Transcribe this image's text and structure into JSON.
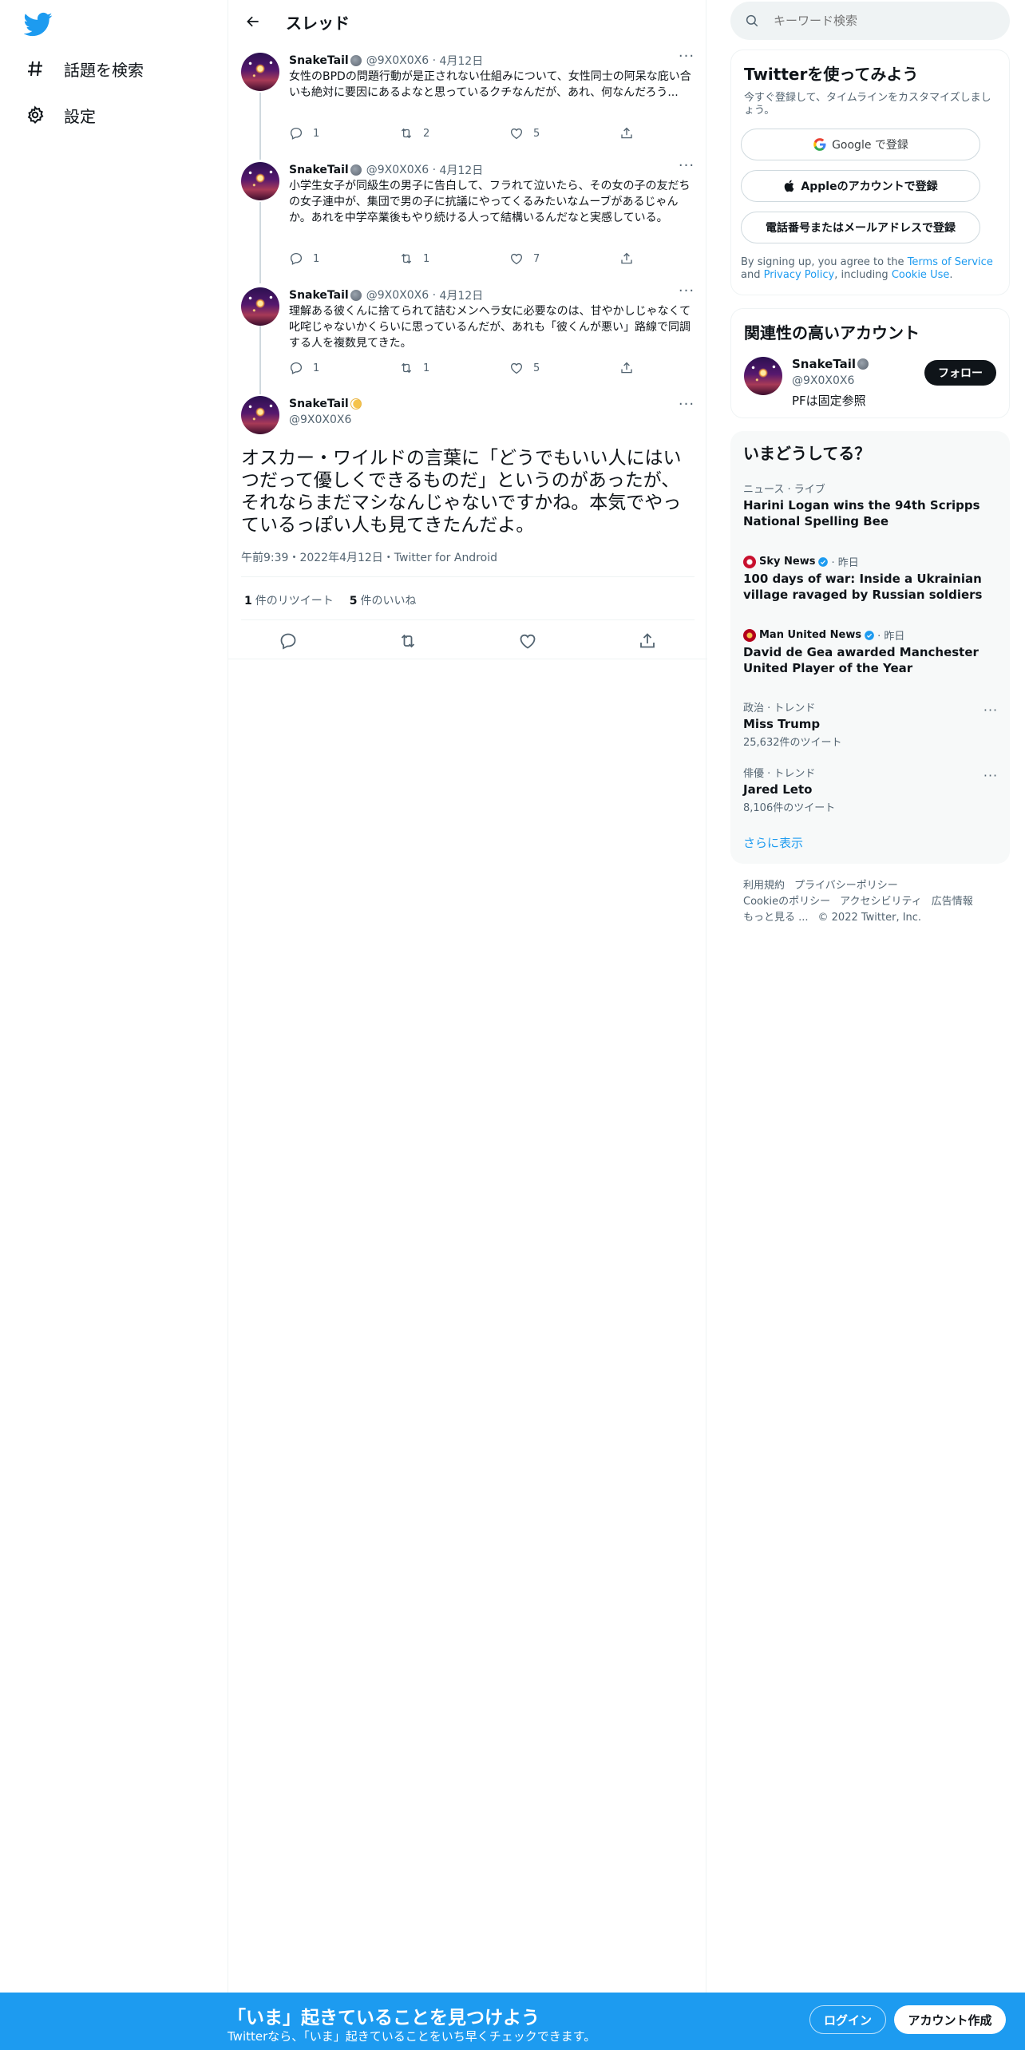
{
  "nav": {
    "items": [
      {
        "label": "話題を検索",
        "icon": "hashtag-icon"
      },
      {
        "label": "設定",
        "icon": "gear-icon"
      }
    ]
  },
  "header": {
    "title": "スレッド"
  },
  "thread": [
    {
      "name": "SnakeTail",
      "handle": "@9X0X0X6",
      "date": "4月12日",
      "text": "女性のBPDの問題行動が是正されない仕組みについて、女性同士の阿呆な庇い合いも絶対に要因にあるよなと思っているクチなんだが、あれ、何なんだろう...",
      "replies": "1",
      "retweets": "2",
      "likes": "5"
    },
    {
      "name": "SnakeTail",
      "handle": "@9X0X0X6",
      "date": "4月12日",
      "text": "小学生女子が同級生の男子に告白して、フラれて泣いたら、その女の子の友だちの女子連中が、集団で男の子に抗議にやってくるみたいなムーブがあるじゃんか。あれを中学卒業後もやり続ける人って結構いるんだなと実感している。",
      "replies": "1",
      "retweets": "1",
      "likes": "7"
    },
    {
      "name": "SnakeTail",
      "handle": "@9X0X0X6",
      "date": "4月12日",
      "text": "理解ある彼くんに捨てられて詰むメンヘラ女に必要なのは、甘やかしじゃなくて叱咤じゃないかくらいに思っているんだが、あれも「彼くんが悪い」路線で同調する人を複数見てきた。",
      "replies": "1",
      "retweets": "1",
      "likes": "5"
    }
  ],
  "main_tweet": {
    "name": "SnakeTail",
    "handle": "@9X0X0X6",
    "text": "オスカー・ワイルドの言葉に「どうでもいい人にはいつだって優しくできるものだ」というのがあったが、それならまだマシなんじゃないですかね。本気でやっているっぽい人も見てきたんだよ。",
    "meta": "午前9:39・2022年4月12日・Twitter for Android",
    "retweet_count": "1",
    "retweet_label": "件のリツイート",
    "like_count": "5",
    "like_label": "件のいいね"
  },
  "search": {
    "placeholder": "キーワード検索"
  },
  "signup": {
    "title": "Twitterを使ってみよう",
    "subtitle": "今すぐ登録して、タイムラインをカスタマイズしましょう。",
    "google": "Google で登録",
    "apple": "Appleのアカウントで登録",
    "phone": "電話番号またはメールアドレスで登録",
    "legal_prefix": "By signing up, you agree to the ",
    "terms": "Terms of Service",
    "and": " and ",
    "privacy": "Privacy Policy",
    "including": ", including ",
    "cookie": "Cookie Use",
    "period": "."
  },
  "related": {
    "title": "関連性の高いアカウント",
    "name": "SnakeTail",
    "handle": "@9X0X0X6",
    "bio": "PFは固定参照",
    "follow": "フォロー"
  },
  "trends": {
    "title": "いまどうしてる？",
    "items": [
      {
        "meta": "ニュース · ライブ",
        "title": "Harini Logan wins the 94th Scripps National Spelling Bee"
      },
      {
        "source": "Sky News",
        "when": "· 昨日",
        "title": "100 days of war: Inside a Ukrainian village ravaged by Russian soldiers"
      },
      {
        "source": "Man United News",
        "when": "· 昨日",
        "title": "David de Gea awarded Manchester United Player of the Year"
      },
      {
        "meta": "政治 · トレンド",
        "title": "Miss Trump",
        "count": "25,632件のツイート"
      },
      {
        "meta": "俳優 · トレンド",
        "title": "Jared Leto",
        "count": "8,106件のツイート"
      }
    ],
    "show_more": "さらに表示"
  },
  "footer": {
    "links": [
      "利用規約",
      "プライバシーポリシー",
      "Cookieのポリシー",
      "アクセシビリティ",
      "広告情報",
      "もっと見る ..."
    ],
    "copyright": "© 2022 Twitter, Inc."
  },
  "banner": {
    "title": "「いま」起きていることを見つけよう",
    "subtitle": "Twitterなら、「いま」起きていることをいち早くチェックできます。",
    "login": "ログイン",
    "signup": "アカウント作成"
  },
  "colors": {
    "accent": "#1d9bf0",
    "text": "#0f1419",
    "muted": "#536471"
  }
}
